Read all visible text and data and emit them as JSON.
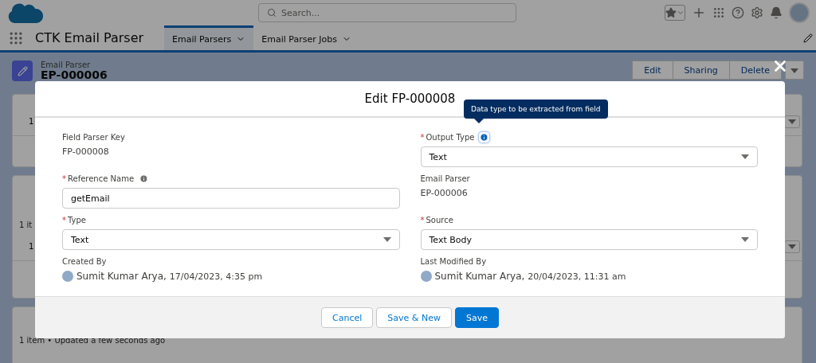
{
  "header": {
    "search": {
      "placeholder": "Search..."
    }
  },
  "nav": {
    "app_name": "CTK Email Parser",
    "tabs": [
      {
        "label": "Email Parsers",
        "selected": true
      },
      {
        "label": "Email Parser Jobs",
        "selected": false
      }
    ]
  },
  "record": {
    "type": "Email Parser",
    "name": "EP-000006",
    "actions": [
      "Edit",
      "Sharing",
      "Delete"
    ]
  },
  "related": [
    {
      "rows": [
        "1"
      ]
    },
    {
      "meta": "1 it",
      "rows": [
        "1"
      ]
    },
    {
      "meta": "1 item • Updated a few seconds ago"
    }
  ],
  "modal": {
    "title": "Edit FP-000008",
    "tooltip": "Data type to be extracted from field",
    "fields": [
      {
        "kind": "readonly",
        "label": "Field Parser Key",
        "value": "FP-000008"
      },
      {
        "kind": "select",
        "required_mark": "*",
        "label": "Output Type",
        "info": true,
        "focused": true,
        "value": "Text"
      },
      {
        "kind": "input",
        "required_mark": "*",
        "label": "Reference Name",
        "info": true,
        "focused": false,
        "value": "getEmail"
      },
      {
        "kind": "readonly",
        "label": "Email Parser",
        "value": "EP-000006"
      },
      {
        "kind": "select",
        "required_mark": "*",
        "label": "Type",
        "value": "Text"
      },
      {
        "kind": "select",
        "required_mark": "*",
        "label": "Source",
        "value": "Text Body"
      },
      {
        "kind": "user",
        "label": "Created By",
        "user": "Sumit Kumar Arya,",
        "date": "17/04/2023, 4:35 pm"
      },
      {
        "kind": "user",
        "label": "Last Modified By",
        "user": "Sumit Kumar Arya,",
        "date": "20/04/2023, 11:31 am"
      }
    ],
    "buttons": [
      {
        "label": "Cancel",
        "kind": "neutral"
      },
      {
        "label": "Save & New",
        "kind": "neutral"
      },
      {
        "label": "Save",
        "kind": "brand"
      }
    ]
  }
}
